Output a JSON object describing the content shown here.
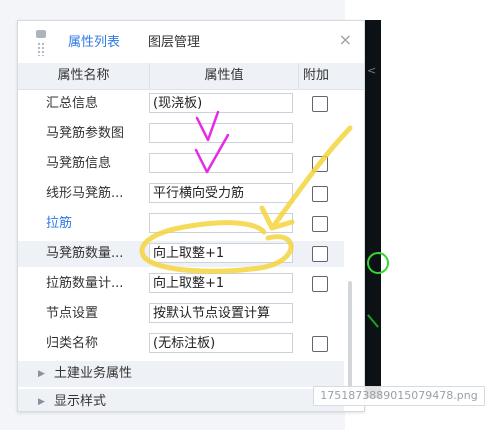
{
  "tabs": [
    {
      "label": "属性列表",
      "active": true
    },
    {
      "label": "图层管理",
      "active": false
    }
  ],
  "close_label": "×",
  "table": {
    "headers": {
      "name": "属性名称",
      "value": "属性值",
      "extra": "附加"
    },
    "rows": [
      {
        "name": "汇总信息",
        "value": "(现浇板)",
        "link": false,
        "checkbox": true,
        "highlight": false
      },
      {
        "name": "马凳筋参数图",
        "value": "",
        "link": false,
        "checkbox": false,
        "highlight": false
      },
      {
        "name": "马凳筋信息",
        "value": "",
        "link": false,
        "checkbox": true,
        "highlight": false
      },
      {
        "name": "线形马凳筋...",
        "value": "平行横向受力筋",
        "link": false,
        "checkbox": true,
        "highlight": false
      },
      {
        "name": "拉筋",
        "value": "",
        "link": true,
        "checkbox": true,
        "highlight": false
      },
      {
        "name": "马凳筋数量...",
        "value": "向上取整+1",
        "link": false,
        "checkbox": true,
        "highlight": true
      },
      {
        "name": "拉筋数量计...",
        "value": "向上取整+1",
        "link": false,
        "checkbox": true,
        "highlight": false
      },
      {
        "name": "节点设置",
        "value": "按默认节点设置计算",
        "link": false,
        "checkbox": false,
        "highlight": false
      },
      {
        "name": "归类名称",
        "value": "(无标注板)",
        "link": false,
        "checkbox": true,
        "highlight": false
      }
    ]
  },
  "sections": [
    {
      "label": "土建业务属性",
      "icon": "triangle-right-icon"
    },
    {
      "label": "显示样式",
      "icon": "triangle-right-icon"
    }
  ],
  "watermark": "1751873889015079478.png",
  "colors": {
    "accent": "#2f7ae5",
    "annotation_magenta": "#e62ae6",
    "annotation_yellow": "#f5d33c"
  }
}
